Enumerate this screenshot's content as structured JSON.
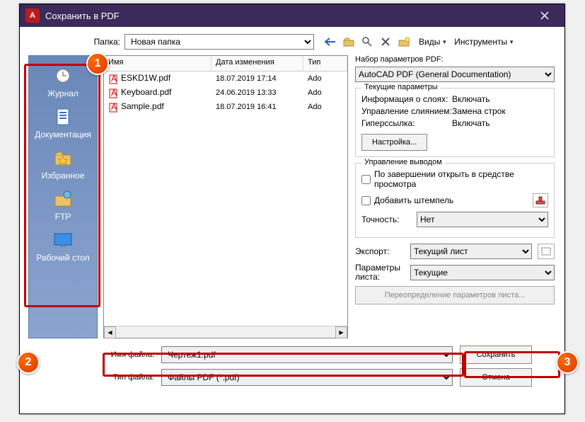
{
  "window": {
    "title": "Сохранить в PDF",
    "app_icon_letter": "A"
  },
  "top": {
    "folder_label": "Папка:",
    "folder_value": "Новая папка",
    "menu_views": "Виды",
    "menu_tools": "Инструменты"
  },
  "places": [
    {
      "label": "Журнал",
      "icon": "clock"
    },
    {
      "label": "Документация",
      "icon": "doc"
    },
    {
      "label": "Избранное",
      "icon": "star"
    },
    {
      "label": "FTP",
      "icon": "ftp"
    },
    {
      "label": "Рабочий стол",
      "icon": "desktop"
    }
  ],
  "file_list": {
    "headers": {
      "name": "Имя",
      "date": "Дата изменения",
      "type": "Тип"
    },
    "rows": [
      {
        "name": "ESKD1W.pdf",
        "date": "18.07.2019 17:14",
        "type": "Ado"
      },
      {
        "name": "Keyboard.pdf",
        "date": "24.06.2019 13:33",
        "type": "Ado"
      },
      {
        "name": "Sample.pdf",
        "date": "18.07.2019 16:41",
        "type": "Ado"
      }
    ]
  },
  "right": {
    "preset_label": "Набор параметров PDF:",
    "preset_value": "AutoCAD PDF (General Documentation)",
    "current_group": "Текущие параметры",
    "kv": [
      {
        "k": "Информация о слоях:",
        "v": "Включать"
      },
      {
        "k": "Управление слиянием:",
        "v": "Замена строк"
      },
      {
        "k": "Гиперссылка:",
        "v": "Включать"
      }
    ],
    "settings_btn": "Настройка...",
    "output_group": "Управление выводом",
    "chk_open": "По завершении открыть в средстве просмотра",
    "chk_stamp": "Добавить штемпель",
    "precision_label": "Точность:",
    "precision_value": "Нет",
    "export_label": "Экспорт:",
    "export_value": "Текущий лист",
    "sheet_params_label": "Параметры листа:",
    "sheet_params_value": "Текущие",
    "override_btn": "Переопределение параметров листа..."
  },
  "bottom": {
    "filename_label": "Имя файла:",
    "filename_value": "Чертеж1.pdf",
    "filetype_label": "Тип файла:",
    "filetype_value": "Файлы PDF (*.pdf)",
    "save_btn": "Сохранить",
    "cancel_btn": "Отмена"
  },
  "badges": {
    "b1": "1",
    "b2": "2",
    "b3": "3"
  }
}
